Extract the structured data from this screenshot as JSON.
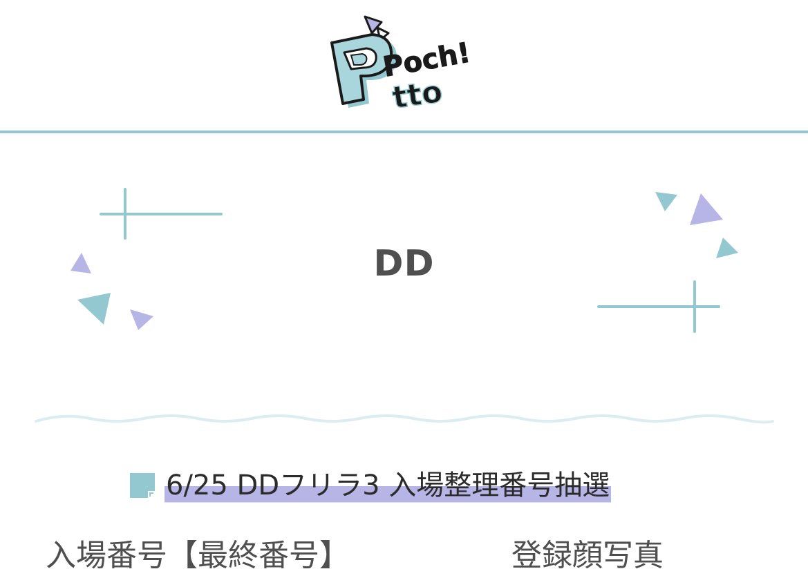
{
  "header": {
    "logo_text_line1": "Poch!",
    "logo_text_line2": "tto"
  },
  "hero": {
    "title": "DD"
  },
  "event": {
    "title": "6/25 DDフリラ3 入場整理番号抽選"
  },
  "fields": {
    "entry_number_label": "入場番号【最終番号】",
    "face_photo_label": "登録顔写真"
  },
  "colors": {
    "teal": "#93c8d1",
    "lavender": "#b7b4e6",
    "wave": "#dcedf1",
    "text": "#4f4f4f"
  },
  "icons": {
    "note": "note-icon",
    "logo": "pochitto-logo"
  }
}
